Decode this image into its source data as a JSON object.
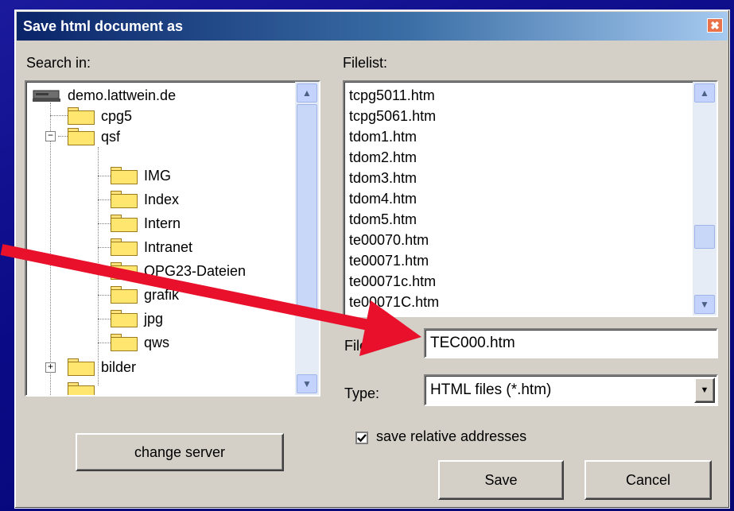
{
  "dialog": {
    "title": "Save html document as",
    "close_glyph": "✖"
  },
  "search": {
    "label": "Search in:",
    "tree": [
      {
        "label": "demo.lattwein.de",
        "icon": "computer-icon"
      },
      {
        "label": "cpg5",
        "icon": "folder-icon"
      },
      {
        "label": "qsf",
        "icon": "open-folder-icon",
        "expander": "−"
      },
      {
        "label": "IMG",
        "icon": "folder-icon"
      },
      {
        "label": "Index",
        "icon": "folder-icon"
      },
      {
        "label": "Intern",
        "icon": "folder-icon"
      },
      {
        "label": "Intranet",
        "icon": "folder-icon"
      },
      {
        "label": "QPG23-Dateien",
        "icon": "folder-icon"
      },
      {
        "label": "grafik",
        "icon": "folder-icon"
      },
      {
        "label": "jpg",
        "icon": "folder-icon"
      },
      {
        "label": "qws",
        "icon": "folder-icon"
      },
      {
        "label": "bilder",
        "icon": "folder-icon",
        "expander": "+"
      }
    ]
  },
  "filelist": {
    "label": "Filelist:",
    "items": [
      "tcpg5011.htm",
      "tcpg5061.htm",
      "tdom1.htm",
      "tdom2.htm",
      "tdom3.htm",
      "tdom4.htm",
      "tdom5.htm",
      "te00070.htm",
      "te00071.htm",
      "te00071c.htm",
      "te00071C.htm"
    ]
  },
  "file": {
    "label": "File:",
    "value": "TEC000.htm"
  },
  "type": {
    "label": "Type:",
    "value": "HTML files (*.htm)"
  },
  "options": {
    "relative_label": "save relative addresses",
    "relative_checked": true
  },
  "buttons": {
    "change_server": "change server",
    "save": "Save",
    "cancel": "Cancel"
  },
  "colors": {
    "annotation_arrow": "#e8102a",
    "titlebar": "#0a246a"
  }
}
